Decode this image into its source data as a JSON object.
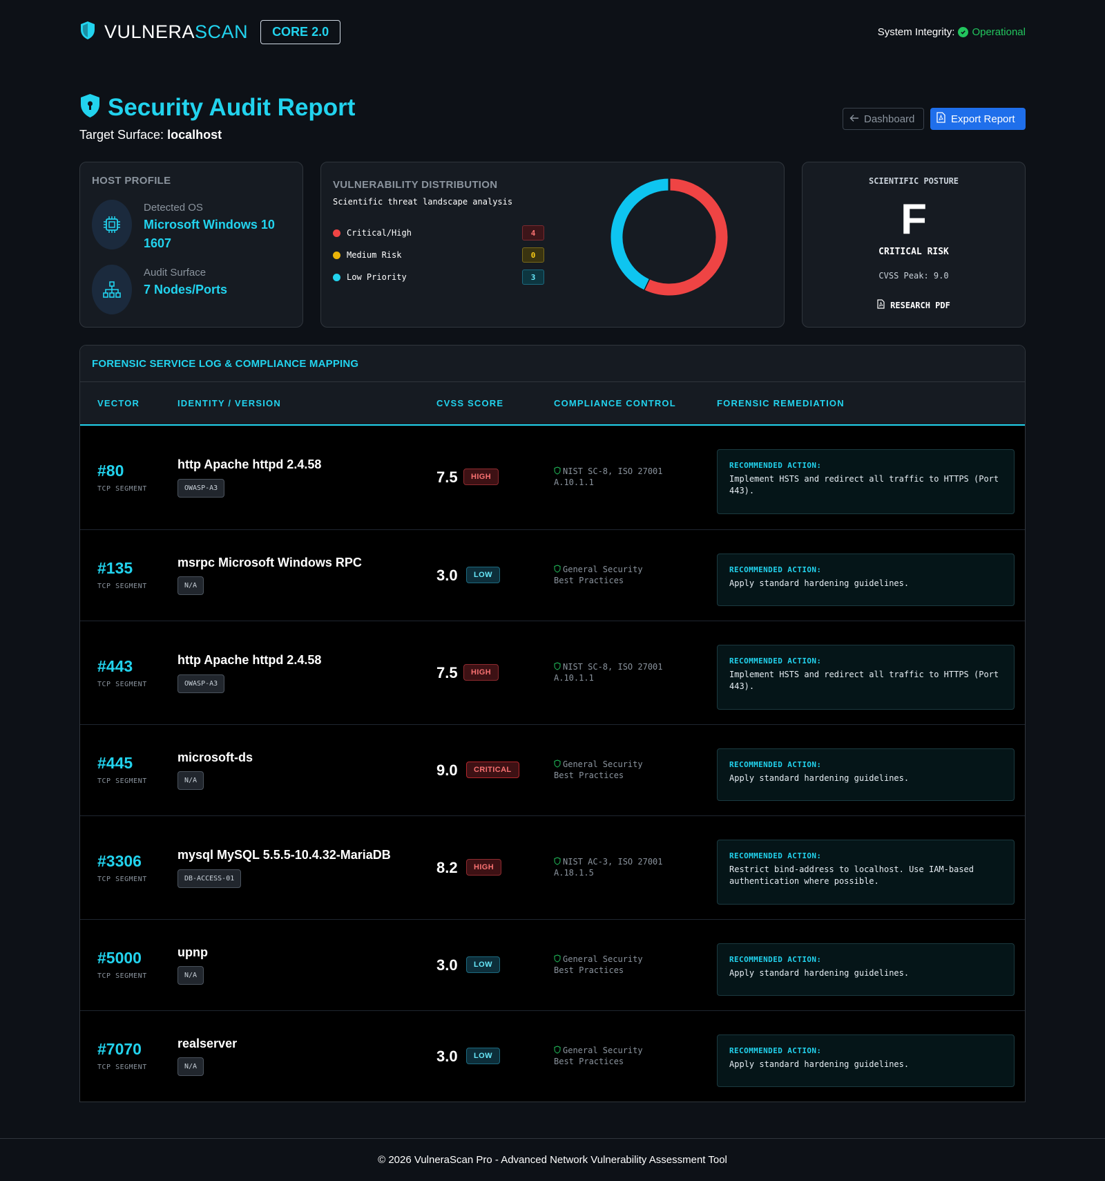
{
  "header": {
    "brand_main": "VULNERA",
    "brand_accent": "SCAN",
    "version_badge": "CORE 2.0",
    "integrity_label": "System Integrity:",
    "integrity_status": "Operational"
  },
  "page": {
    "title": "Security Audit Report",
    "target_label": "Target Surface:",
    "target_value": "localhost",
    "dashboard_button": "Dashboard",
    "export_button": "Export Report"
  },
  "host_profile": {
    "label": "HOST PROFILE",
    "os_label": "Detected OS",
    "os_value_line1": "Microsoft Windows 10",
    "os_value_line2": "1607",
    "surface_label": "Audit Surface",
    "surface_value": "7 Nodes/Ports"
  },
  "distribution": {
    "label": "VULNERABILITY DISTRIBUTION",
    "subtitle": "Scientific threat landscape analysis",
    "items": [
      {
        "label": "Critical/High",
        "count": "4",
        "color": "#ef4444"
      },
      {
        "label": "Medium Risk",
        "count": "0",
        "color": "#eab308"
      },
      {
        "label": "Low Priority",
        "count": "3",
        "color": "#22d3ee"
      }
    ]
  },
  "chart_data": {
    "type": "pie",
    "categories": [
      "Critical/High",
      "Medium Risk",
      "Low Priority"
    ],
    "values": [
      4,
      0,
      3
    ],
    "colors": [
      "#ef4444",
      "#eab308",
      "#0ec5f0"
    ]
  },
  "posture": {
    "label": "SCIENTIFIC POSTURE",
    "grade": "F",
    "risk": "CRITICAL RISK",
    "peak": "CVSS Peak: 9.0",
    "pdf_button": "RESEARCH PDF"
  },
  "table": {
    "title": "FORENSIC SERVICE LOG & COMPLIANCE MAPPING",
    "columns": [
      "VECTOR",
      "IDENTITY / VERSION",
      "CVSS SCORE",
      "COMPLIANCE CONTROL",
      "FORENSIC REMEDIATION"
    ],
    "segment_label": "TCP SEGMENT",
    "action_label": "RECOMMENDED ACTION:",
    "rows": [
      {
        "port": "#80",
        "service": "http Apache httpd 2.4.58",
        "tag": "OWASP-A3",
        "score": "7.5",
        "severity": "HIGH",
        "compliance_1": "NIST SC-8, ISO 27001",
        "compliance_2": "A.10.1.1",
        "remediation": "Implement HSTS and redirect all traffic to HTTPS (Port 443)."
      },
      {
        "port": "#135",
        "service": "msrpc Microsoft Windows RPC",
        "tag": "N/A",
        "score": "3.0",
        "severity": "LOW",
        "compliance_1": "General Security",
        "compliance_2": "Best Practices",
        "remediation": "Apply standard hardening guidelines."
      },
      {
        "port": "#443",
        "service": "http Apache httpd 2.4.58",
        "tag": "OWASP-A3",
        "score": "7.5",
        "severity": "HIGH",
        "compliance_1": "NIST SC-8, ISO 27001",
        "compliance_2": "A.10.1.1",
        "remediation": "Implement HSTS and redirect all traffic to HTTPS (Port 443)."
      },
      {
        "port": "#445",
        "service": "microsoft-ds",
        "tag": "N/A",
        "score": "9.0",
        "severity": "CRITICAL",
        "compliance_1": "General Security",
        "compliance_2": "Best Practices",
        "remediation": "Apply standard hardening guidelines."
      },
      {
        "port": "#3306",
        "service": "mysql MySQL 5.5.5-10.4.32-MariaDB",
        "tag": "DB-ACCESS-01",
        "score": "8.2",
        "severity": "HIGH",
        "compliance_1": "NIST AC-3, ISO 27001",
        "compliance_2": "A.18.1.5",
        "remediation": "Restrict bind-address to localhost. Use IAM-based authentication where possible."
      },
      {
        "port": "#5000",
        "service": "upnp",
        "tag": "N/A",
        "score": "3.0",
        "severity": "LOW",
        "compliance_1": "General Security",
        "compliance_2": "Best Practices",
        "remediation": "Apply standard hardening guidelines."
      },
      {
        "port": "#7070",
        "service": "realserver",
        "tag": "N/A",
        "score": "3.0",
        "severity": "LOW",
        "compliance_1": "General Security",
        "compliance_2": "Best Practices",
        "remediation": "Apply standard hardening guidelines."
      }
    ]
  },
  "footer": {
    "text": "© 2026 VulneraScan Pro - Advanced Network Vulnerability Assessment Tool"
  }
}
